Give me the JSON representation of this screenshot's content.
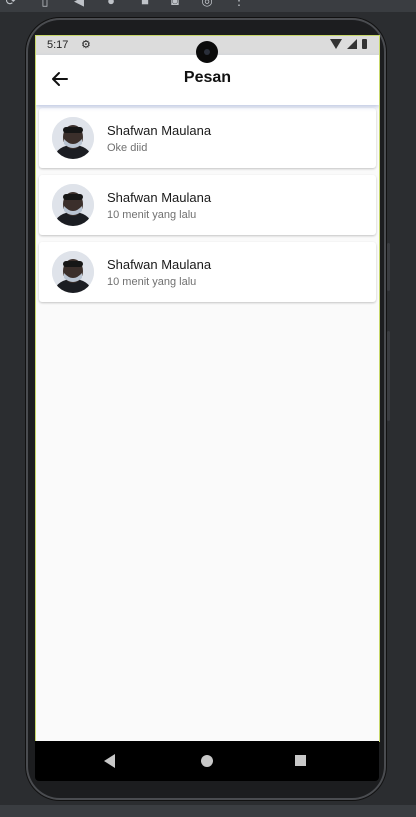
{
  "status_bar": {
    "time": "5:17",
    "icons": [
      "gear-icon",
      "wifi-icon",
      "signal-icon",
      "battery-icon"
    ]
  },
  "app_bar": {
    "title": "Pesan",
    "back_icon": "arrow-left-icon"
  },
  "messages": [
    {
      "name": "Shafwan Maulana",
      "preview": "Oke diid"
    },
    {
      "name": "Shafwan Maulana",
      "preview": "10 menit yang lalu"
    },
    {
      "name": "Shafwan Maulana",
      "preview": "10 menit yang lalu"
    }
  ],
  "navigation_bar": {
    "icons": [
      "nav-back-icon",
      "nav-home-icon",
      "nav-recents-icon"
    ]
  },
  "colors": {
    "background": "#fafafa",
    "card": "#ffffff",
    "appbar_shadow": "#7c8cc8",
    "screen_border": "#c8d86a"
  }
}
